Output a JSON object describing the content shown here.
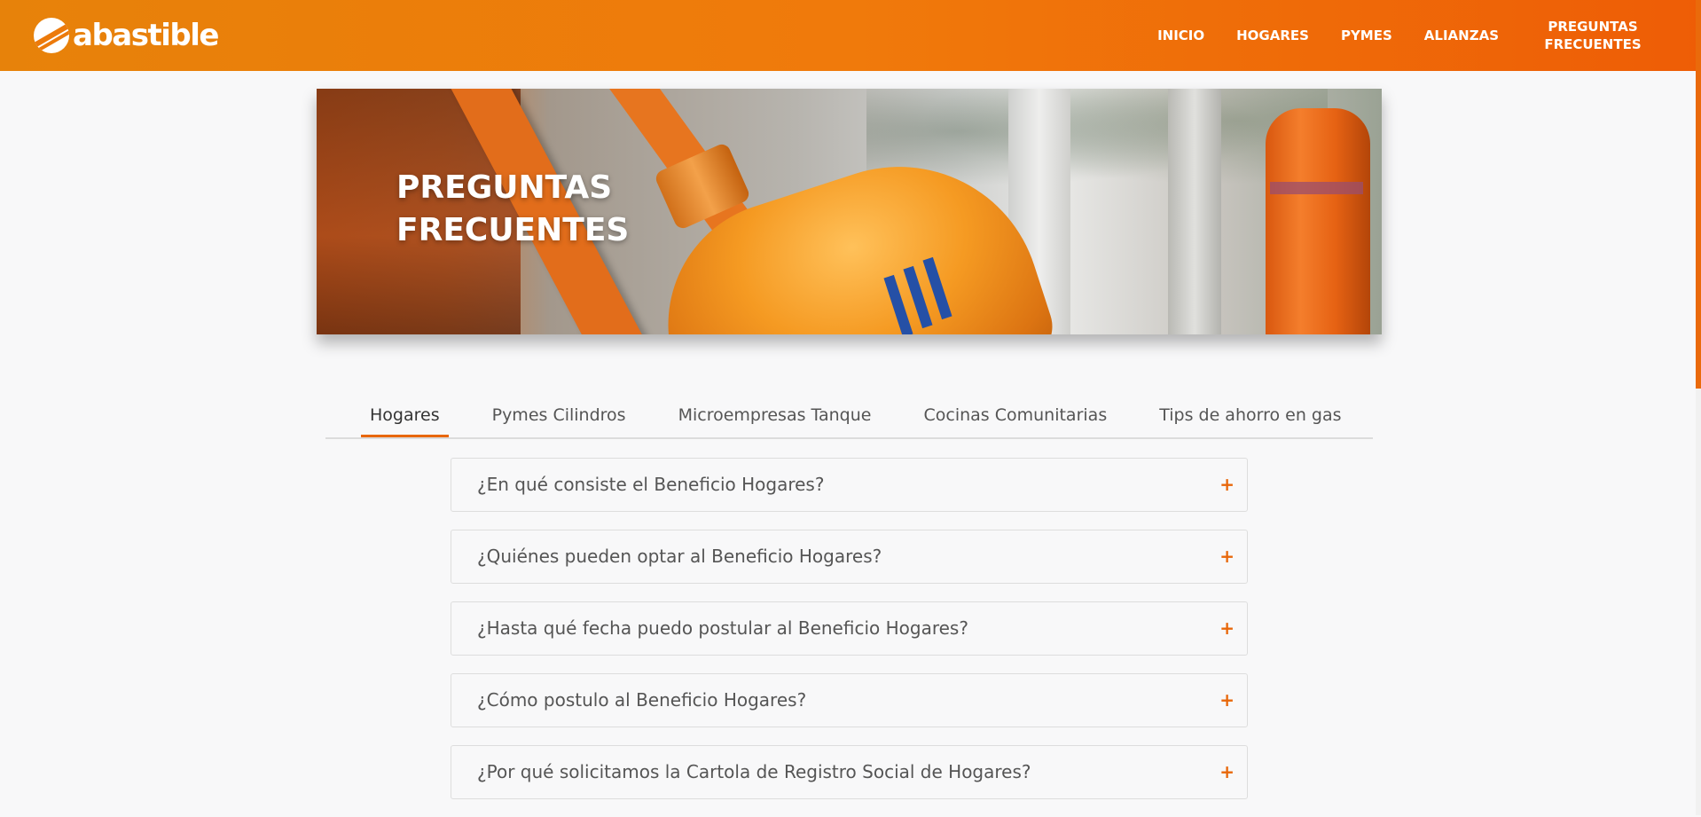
{
  "brand": {
    "name": "abastible",
    "logo_icon": "abastible-logo-icon",
    "colors": {
      "primary": "#ec7a0b",
      "accent": "#e8670a",
      "background": "#f8f8f9"
    }
  },
  "nav": {
    "items": [
      {
        "label": "INICIO"
      },
      {
        "label": "HOGARES"
      },
      {
        "label": "PYMES"
      },
      {
        "label": "ALIANZAS"
      },
      {
        "label": "PREGUNTAS FRECUENTES"
      }
    ]
  },
  "hero": {
    "title": "PREGUNTAS FRECUENTES"
  },
  "tabs": {
    "items": [
      {
        "label": "Hogares",
        "active": true
      },
      {
        "label": "Pymes Cilindros",
        "active": false
      },
      {
        "label": "Microempresas Tanque",
        "active": false
      },
      {
        "label": "Cocinas Comunitarias",
        "active": false
      },
      {
        "label": "Tips de ahorro en gas",
        "active": false
      }
    ]
  },
  "faq": {
    "expand_icon": "+",
    "items": [
      {
        "question": "¿En qué consiste el Beneficio Hogares?"
      },
      {
        "question": "¿Quiénes pueden optar al Beneficio Hogares?"
      },
      {
        "question": "¿Hasta qué fecha puedo postular al Beneficio Hogares?"
      },
      {
        "question": "¿Cómo postulo al Beneficio Hogares?"
      },
      {
        "question": "¿Por qué solicitamos la Cartola de Registro Social de Hogares?"
      }
    ]
  }
}
